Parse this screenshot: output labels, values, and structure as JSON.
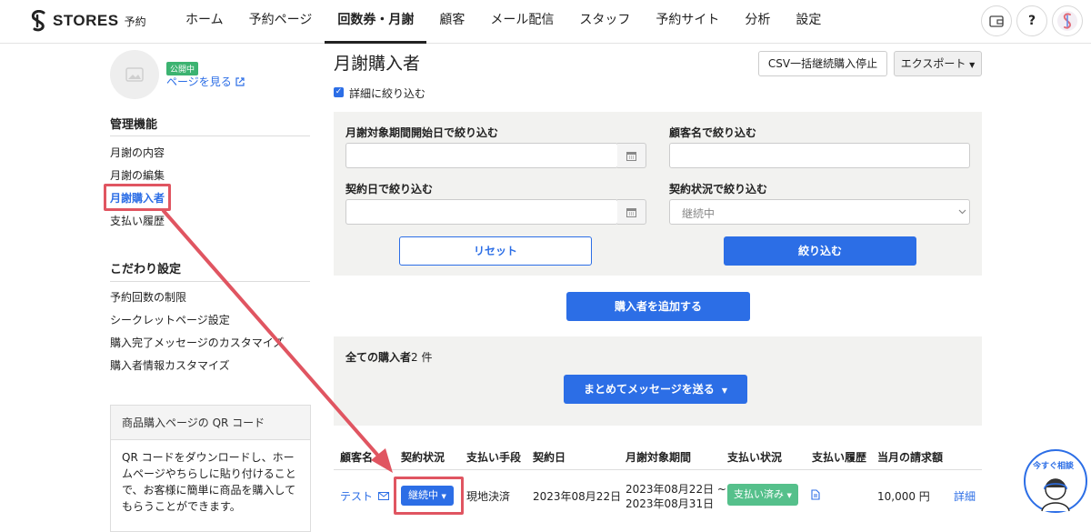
{
  "header": {
    "logo_text": "STORES",
    "logo_sub": "予約",
    "nav": [
      "ホーム",
      "予約ページ",
      "回数券・月謝",
      "顧客",
      "メール配信",
      "スタッフ",
      "予約サイト",
      "分析",
      "設定"
    ],
    "active_nav": "回数券・月謝",
    "help_label": "?"
  },
  "sidebar": {
    "public_badge": "公開中",
    "page_link": "ページを見る",
    "section1_title": "管理機能",
    "section1_items": [
      "月謝の内容",
      "月謝の編集",
      "月謝購入者",
      "支払い履歴"
    ],
    "section2_title": "こだわり設定",
    "section2_items": [
      "予約回数の制限",
      "シークレットページ設定",
      "購入完了メッセージのカスタマイズ",
      "購入者情報カスタマイズ"
    ],
    "qr_title": "商品購入ページの QR コード",
    "qr_text_lines": [
      "QR コードをダウンロードし、ホー",
      "ムページやちらしに貼り付けること",
      "で、お客様に簡単に商品を購入して",
      "もらうことができます。"
    ]
  },
  "main": {
    "title": "月謝購入者",
    "csv_button": "CSV一括継続購入停止",
    "export_button": "エクスポート",
    "filter_checkbox_label": "詳細に絞り込む",
    "filters": {
      "period_start_label": "月謝対象期間開始日で絞り込む",
      "customer_name_label": "顧客名で絞り込む",
      "contract_date_label": "契約日で絞り込む",
      "contract_status_label": "契約状況で絞り込む",
      "contract_status_value": "継続中",
      "reset_button": "リセット",
      "apply_button": "絞り込む"
    },
    "add_buyer_button": "購入者を追加する",
    "all_buyers_label": "全ての購入者",
    "all_buyers_count": "2 件",
    "bulk_message_button": "まとめてメッセージを送る",
    "table": {
      "headers": [
        "顧客名",
        "契約状況",
        "支払い手段",
        "契約日",
        "月謝対象期間",
        "支払い状況",
        "支払い履歴",
        "当月の請求額"
      ],
      "rows": [
        {
          "customer": "テスト",
          "status": "継続中",
          "payment_method": "現地決済",
          "contract_date": "2023年08月22日",
          "period_line1": "2023年08月22日 ~",
          "period_line2": "2023年08月31日",
          "payment_status": "支払い済み",
          "amount": "10,000 円",
          "detail_link": "詳細"
        }
      ]
    }
  },
  "chat": {
    "label": "今すぐ相談"
  },
  "colors": {
    "accent": "#2c6ee6",
    "highlight": "#e05561",
    "paid": "#55c08b"
  }
}
